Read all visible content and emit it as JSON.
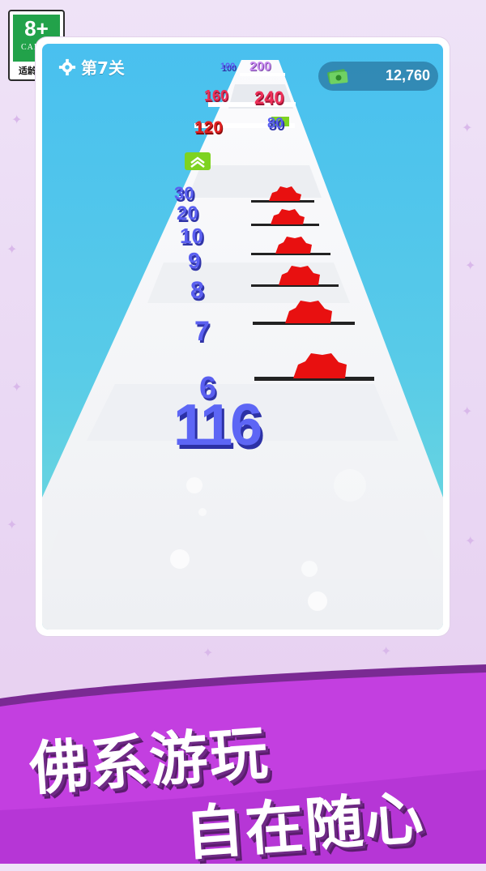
{
  "age_rating": {
    "rating": "8+",
    "org": "CADPA",
    "tip": "适龄提示"
  },
  "hud": {
    "level": "第7关",
    "cash": "12,760"
  },
  "gates": [
    {
      "value": "100",
      "color": "blue"
    },
    {
      "value": "200",
      "color": "pink"
    },
    {
      "value": "160",
      "color": "red"
    },
    {
      "value": "240",
      "color": "red"
    },
    {
      "value": "120",
      "color": "red"
    },
    {
      "value": "80",
      "color": "blue"
    }
  ],
  "pickups": [
    "30",
    "20",
    "10",
    "9",
    "8",
    "7",
    "6"
  ],
  "player_score": "116",
  "slogan": {
    "line1": "佛系游玩",
    "line2": "自在随心"
  },
  "colors": {
    "sky": "#49c0ef",
    "road": "#ffffff",
    "blade": "#e81010",
    "banner": "#c33fe0",
    "boost": "#7ed321"
  }
}
